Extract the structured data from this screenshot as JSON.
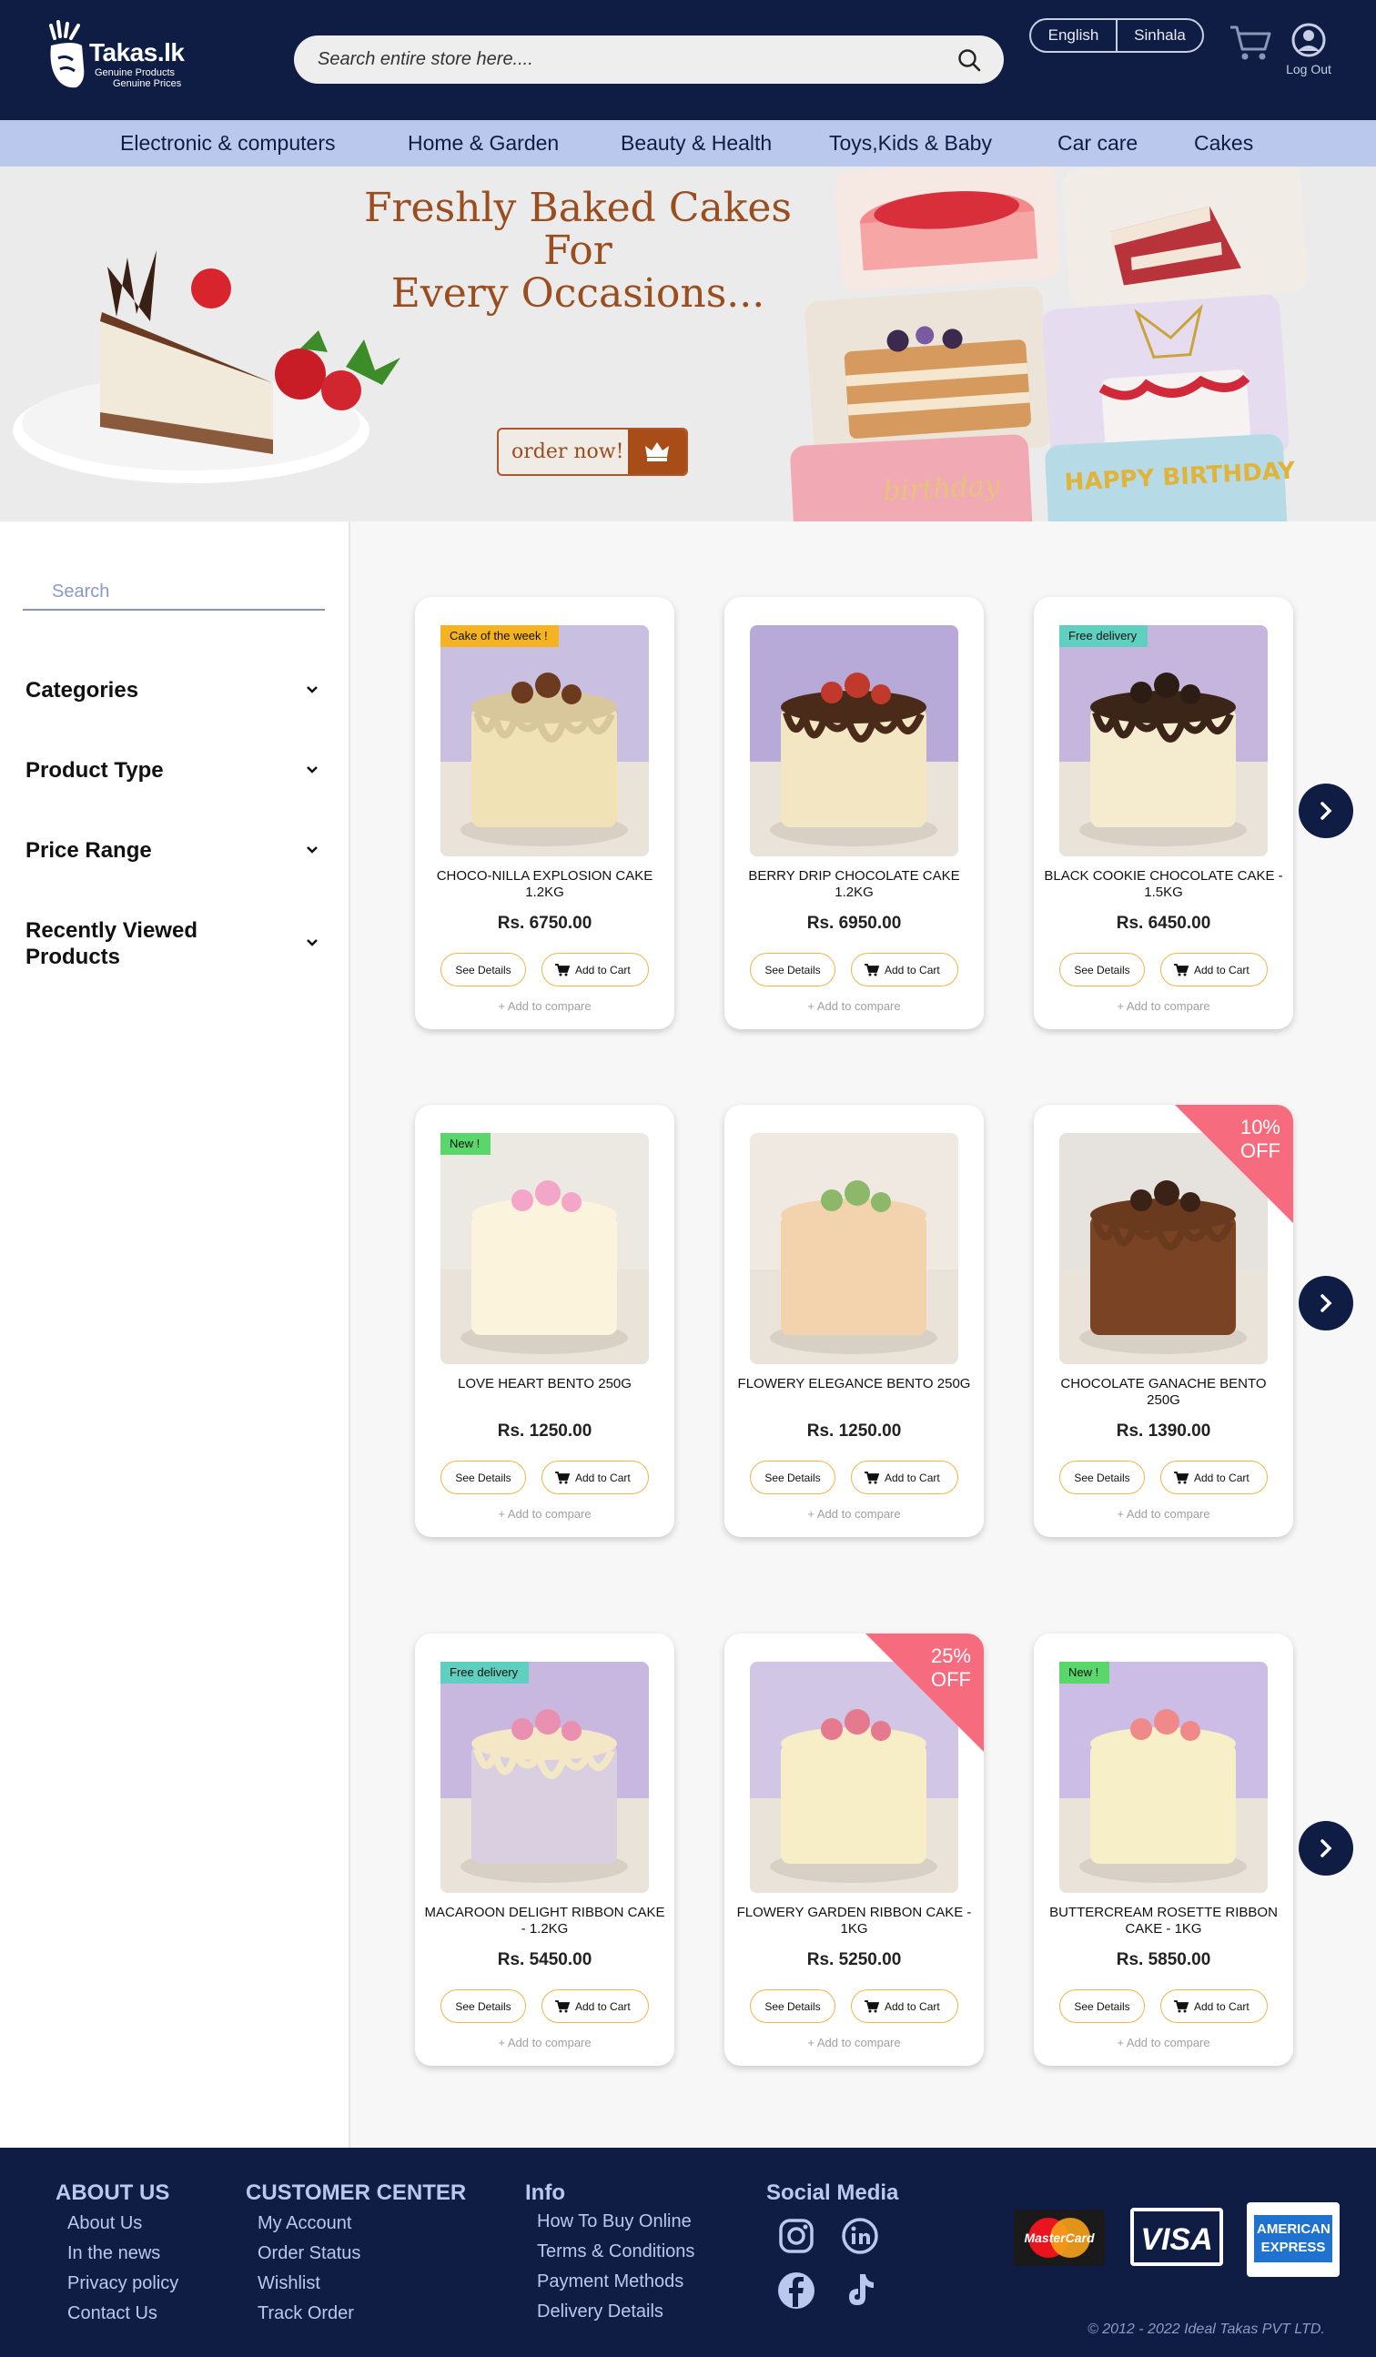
{
  "header": {
    "logo_title": "Takas.lk",
    "logo_sub1": "Genuine Products",
    "logo_sub2": "Genuine Prices",
    "search_placeholder": "Search entire store here....",
    "languages": [
      "English",
      "Sinhala"
    ],
    "logout_label": "Log Out"
  },
  "nav": {
    "items": [
      "Electronic & computers",
      "Home & Garden",
      "Beauty & Health",
      "Toys,Kids & Baby",
      "Car care",
      "Cakes"
    ]
  },
  "banner": {
    "title_line1": "Freshly Baked Cakes",
    "title_line2": "For",
    "title_line3": "Every Occasions...",
    "order_label": "order now!",
    "collage_text_1": "birthday",
    "collage_text_2": "HAPPY BIRTHDAY"
  },
  "sidebar": {
    "search_placeholder": "Search",
    "filters": [
      "Categories",
      "Product Type",
      "Price Range",
      "Recently Viewed Products"
    ]
  },
  "products": [
    {
      "name": "CHOCO-NILLA EXPLOSION CAKE 1.2KG",
      "price": "Rs. 6750.00",
      "badge": "Cake of the week !",
      "badge_color": "#f5b323",
      "ribbon": "",
      "cake_color": "#f1e2b6",
      "drip": "#d8c79a",
      "top": "#6b3a1f",
      "bg": "#c9bfe0"
    },
    {
      "name": "BERRY DRIP CHOCOLATE CAKE 1.2KG",
      "price": "Rs. 6950.00",
      "badge": "",
      "badge_color": "",
      "ribbon": "",
      "cake_color": "#f2e6c3",
      "drip": "#4a2a18",
      "top": "#c0392b",
      "bg": "#b7a9d8"
    },
    {
      "name": "BLACK COOKIE  CHOCOLATE CAKE - 1.5KG",
      "price": "Rs. 6450.00",
      "badge": "Free delivery",
      "badge_color": "#5fd0c0",
      "ribbon": "",
      "cake_color": "#f5ecd0",
      "drip": "#3a2518",
      "top": "#2b1c14",
      "bg": "#c6b6dd"
    },
    {
      "name": "LOVE HEART BENTO 250G",
      "price": "Rs. 1250.00",
      "badge": "New !",
      "badge_color": "#5ad76a",
      "ribbon": "",
      "cake_color": "#fbf3dc",
      "drip": "#fbf3dc",
      "top": "#f3a6c8",
      "bg": "#ece8e2"
    },
    {
      "name": "FLOWERY ELEGANCE BENTO 250G",
      "price": "Rs. 1250.00",
      "badge": "",
      "badge_color": "",
      "ribbon": "",
      "cake_color": "#f3d3ad",
      "drip": "#f3d3ad",
      "top": "#8db86a",
      "bg": "#efe9e1"
    },
    {
      "name": "CHOCOLATE GANACHE BENTO 250G",
      "price": "Rs. 1390.00",
      "badge": "",
      "badge_color": "",
      "ribbon": "10% OFF",
      "cake_color": "#7a4424",
      "drip": "#6a3a1e",
      "top": "#3b2216",
      "bg": "#e6e2dd"
    },
    {
      "name": "MACAROON DELIGHT RIBBON CAKE - 1.2KG",
      "price": "Rs. 5450.00",
      "badge": "Free delivery",
      "badge_color": "#5fd0c0",
      "ribbon": "",
      "cake_color": "#d9cfe0",
      "drip": "#f3e7c6",
      "top": "#e98fb0",
      "bg": "#c8b8e0"
    },
    {
      "name": "FLOWERY GARDEN RIBBON CAKE - 1KG",
      "price": "Rs. 5250.00",
      "badge": "",
      "badge_color": "",
      "ribbon": "25% OFF",
      "cake_color": "#f7edc6",
      "drip": "#f7edc6",
      "top": "#e57a8e",
      "bg": "#d2c6e6"
    },
    {
      "name": "BUTTERCREAM ROSETTE RIBBON CAKE - 1KG",
      "price": "Rs. 5850.00",
      "badge": "New !",
      "badge_color": "#5ad76a",
      "ribbon": "",
      "cake_color": "#f7efc8",
      "drip": "#f7efc8",
      "top": "#f08a8a",
      "bg": "#cbbde5"
    }
  ],
  "product_buttons": {
    "details": "See Details",
    "cart": "Add to Cart",
    "compare": "+ Add to compare"
  },
  "footer": {
    "about_title": "ABOUT US",
    "about_links": [
      "About Us",
      "In the news",
      "Privacy policy",
      "Contact Us"
    ],
    "customer_title": "CUSTOMER CENTER",
    "customer_links": [
      "My Account",
      "Order Status",
      "Wishlist",
      "Track Order"
    ],
    "info_title": "Info",
    "info_links": [
      "How To Buy Online",
      "Terms & Conditions",
      "Payment Methods",
      "Delivery Details"
    ],
    "social_title": "Social Media",
    "social_icons": [
      "instagram-icon",
      "linkedin-icon",
      "facebook-icon",
      "tiktok-icon"
    ],
    "payment": [
      "MasterCard",
      "VISA",
      "AMERICAN EXPRESS"
    ],
    "copyright": "© 2012 - 2022 Ideal Takas PVT LTD."
  },
  "colors": {
    "navy": "#0f1d45",
    "nav_bg": "#b9c8ec",
    "brand_brown": "#9a4d1e",
    "button_border": "#efb54a",
    "discount": "#f76b7f"
  }
}
